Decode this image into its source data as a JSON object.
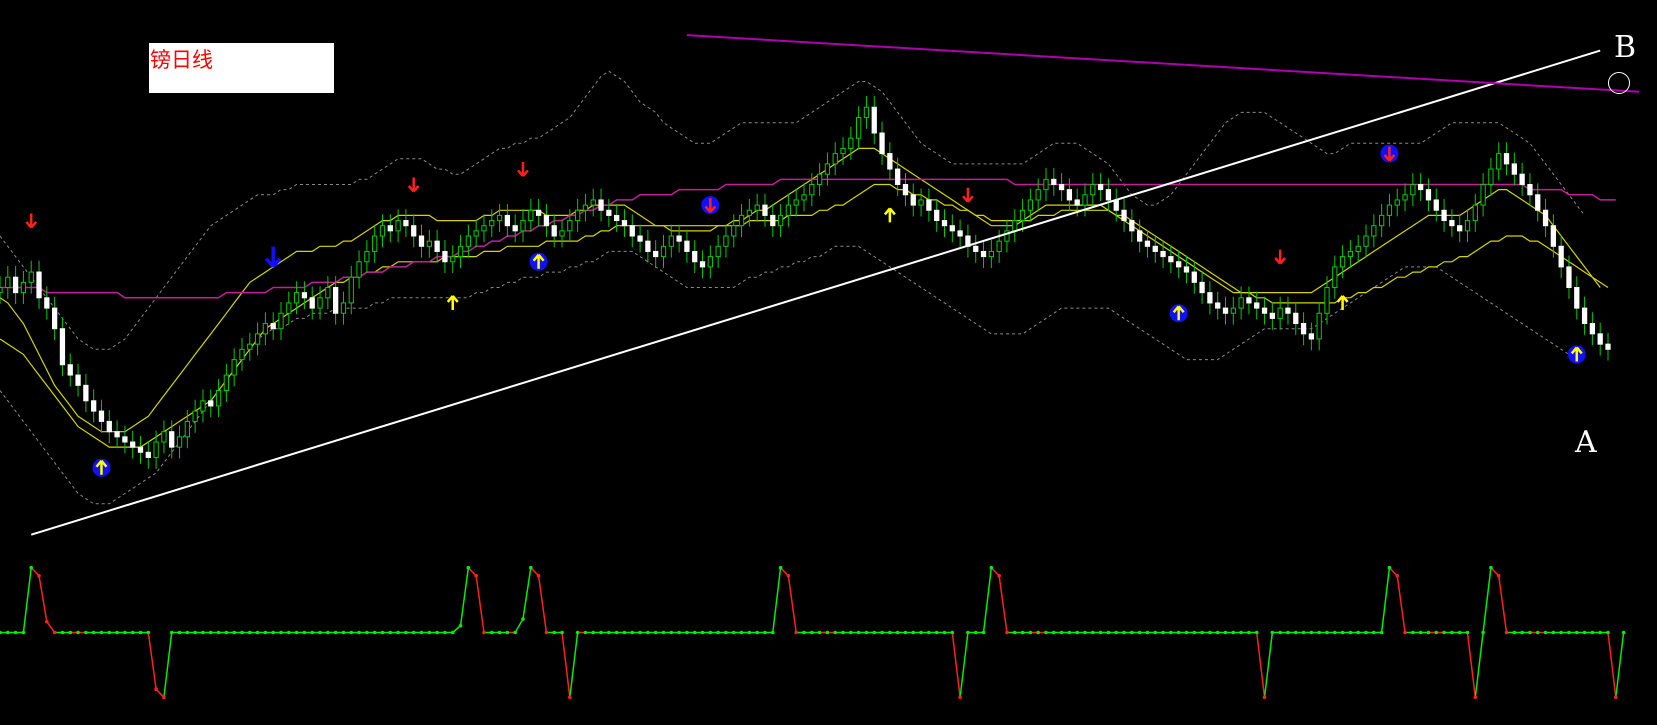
{
  "chart_data": {
    "type": "candlestick",
    "title": "镑日线",
    "point_labels": {
      "a": "A",
      "b": "B"
    },
    "colors": {
      "background": "#000000",
      "up_candle": "#e8ffe0",
      "down_candle": "#ffffff",
      "wick": "#00cc00",
      "bollinger": "#8a8a8a",
      "ma_fast": "#d4d400",
      "ma_long": "#c0209a",
      "trendline_support": "#ffffff",
      "trendline_resistance": "#b000b0",
      "signal_up": "#ffff00",
      "signal_down": "#ff2020",
      "signal_badge": "#1010ff",
      "oscillator_rise": "#00ee00",
      "oscillator_fall": "#ff2020"
    },
    "close": [
      50,
      52,
      49,
      51,
      53,
      48,
      46,
      42,
      35,
      33,
      31,
      28,
      26,
      24,
      22,
      21,
      20,
      19,
      18,
      17,
      20,
      22,
      19,
      21,
      24,
      26,
      28,
      27,
      30,
      33,
      36,
      38,
      39,
      41,
      43,
      42,
      45,
      47,
      49,
      48,
      46,
      48,
      50,
      45,
      47,
      52,
      55,
      57,
      60,
      62,
      61,
      63,
      62,
      60,
      58,
      59,
      57,
      55,
      56,
      58,
      60,
      61,
      62,
      63,
      64,
      62,
      61,
      63,
      65,
      64,
      62,
      60,
      61,
      63,
      65,
      66,
      67,
      65,
      64,
      63,
      62,
      60,
      59,
      57,
      56,
      58,
      60,
      59,
      57,
      55,
      54,
      56,
      58,
      60,
      62,
      64,
      65,
      66,
      64,
      62,
      64,
      66,
      67,
      68,
      70,
      72,
      74,
      76,
      77,
      79,
      83,
      85,
      80,
      76,
      73,
      70,
      68,
      66,
      67,
      65,
      63,
      62,
      61,
      60,
      58,
      57,
      56,
      57,
      59,
      61,
      63,
      65,
      67,
      69,
      71,
      70,
      69,
      67,
      66,
      68,
      70,
      69,
      67,
      65,
      63,
      61,
      59,
      58,
      57,
      56,
      55,
      54,
      53,
      51,
      49,
      47,
      46,
      45,
      46,
      48,
      47,
      46,
      45,
      44,
      46,
      45,
      43,
      41,
      40,
      45,
      50,
      54,
      56,
      57,
      58,
      60,
      62,
      64,
      66,
      67,
      68,
      70,
      69,
      67,
      65,
      63,
      62,
      61,
      63,
      66,
      70,
      73,
      76,
      74,
      72,
      70,
      68,
      65,
      62,
      58,
      54,
      50,
      46,
      43,
      41,
      39,
      38
    ],
    "bollinger_upper": [
      60,
      58,
      56,
      54,
      52,
      50,
      48,
      46,
      44,
      42,
      40,
      39,
      38,
      38,
      38,
      39,
      40,
      42,
      44,
      46,
      48,
      50,
      52,
      54,
      56,
      58,
      60,
      62,
      63,
      64,
      65,
      66,
      67,
      68,
      68,
      68,
      69,
      69,
      70,
      70,
      70,
      70,
      70,
      70,
      70,
      70,
      71,
      71,
      72,
      73,
      74,
      75,
      75,
      75,
      75,
      74,
      73,
      73,
      72,
      72,
      73,
      74,
      75,
      76,
      77,
      77,
      78,
      78,
      79,
      79,
      80,
      81,
      82,
      83,
      85,
      87,
      89,
      91,
      92,
      91,
      90,
      88,
      86,
      85,
      84,
      82,
      81,
      80,
      79,
      78,
      78,
      78,
      79,
      80,
      81,
      82,
      82,
      82,
      82,
      82,
      82,
      82,
      82,
      83,
      84,
      85,
      86,
      87,
      88,
      89,
      90,
      90,
      89,
      88,
      86,
      84,
      82,
      80,
      78,
      77,
      76,
      75,
      74,
      74,
      74,
      74,
      74,
      74,
      74,
      74,
      74,
      74,
      75,
      76,
      77,
      78,
      78,
      78,
      78,
      77,
      76,
      75,
      74,
      72,
      70,
      68,
      67,
      66,
      66,
      67,
      68,
      70,
      72,
      74,
      76,
      78,
      80,
      82,
      83,
      84,
      84,
      84,
      84,
      83,
      82,
      81,
      80,
      79,
      78,
      77,
      76,
      76,
      77,
      78,
      78,
      78,
      78,
      78,
      78,
      78,
      78,
      78,
      78,
      79,
      80,
      81,
      82,
      82,
      82,
      82,
      82,
      82,
      82,
      81,
      80,
      79,
      78,
      76,
      74,
      72,
      70,
      68,
      66,
      64
    ],
    "bollinger_lower": [
      30,
      28,
      26,
      24,
      22,
      20,
      18,
      16,
      14,
      12,
      10,
      9,
      8,
      8,
      8,
      9,
      10,
      11,
      12,
      13,
      14,
      16,
      18,
      20,
      22,
      24,
      26,
      28,
      30,
      32,
      34,
      36,
      38,
      40,
      41,
      42,
      42,
      43,
      44,
      44,
      45,
      45,
      45,
      46,
      46,
      46,
      46,
      46,
      47,
      47,
      48,
      48,
      48,
      48,
      48,
      48,
      48,
      48,
      48,
      48,
      48,
      49,
      49,
      50,
      50,
      51,
      51,
      52,
      52,
      52,
      53,
      53,
      53,
      54,
      54,
      55,
      55,
      56,
      57,
      57,
      57,
      57,
      56,
      55,
      54,
      53,
      52,
      51,
      50,
      50,
      50,
      50,
      50,
      50,
      50,
      51,
      52,
      52,
      53,
      53,
      54,
      54,
      55,
      55,
      56,
      56,
      57,
      58,
      58,
      58,
      58,
      57,
      56,
      55,
      54,
      53,
      52,
      51,
      50,
      49,
      48,
      47,
      46,
      45,
      44,
      43,
      42,
      41,
      41,
      41,
      41,
      41,
      42,
      43,
      44,
      45,
      46,
      46,
      46,
      46,
      46,
      46,
      46,
      45,
      44,
      43,
      42,
      41,
      40,
      39,
      38,
      37,
      36,
      36,
      36,
      36,
      36,
      37,
      38,
      39,
      40,
      41,
      42,
      42,
      42,
      42,
      42,
      42,
      42,
      43,
      44,
      45,
      46,
      47,
      48,
      49,
      50,
      51,
      52,
      53,
      54,
      54,
      54,
      54,
      54,
      53,
      52,
      51,
      50,
      49,
      48,
      47,
      46,
      45,
      44,
      43,
      42,
      41,
      40,
      39,
      38,
      37,
      36
    ],
    "ma_fast": [
      48,
      47,
      45,
      43,
      40,
      37,
      34,
      31,
      29,
      27,
      25,
      24,
      23,
      22,
      22,
      22,
      22,
      23,
      24,
      25,
      27,
      29,
      31,
      33,
      35,
      37,
      39,
      41,
      43,
      45,
      47,
      49,
      51,
      52,
      53,
      54,
      55,
      56,
      57,
      57,
      57,
      58,
      58,
      58,
      59,
      59,
      60,
      61,
      62,
      63,
      63,
      64,
      64,
      64,
      64,
      64,
      63,
      63,
      63,
      63,
      63,
      63,
      64,
      64,
      65,
      65,
      65,
      65,
      65,
      65,
      64,
      64,
      64,
      64,
      65,
      65,
      66,
      66,
      66,
      66,
      66,
      65,
      64,
      63,
      62,
      62,
      61,
      61,
      61,
      61,
      61,
      61,
      62,
      62,
      63,
      63,
      64,
      65,
      65,
      66,
      67,
      68,
      69,
      70,
      71,
      72,
      73,
      74,
      75,
      76,
      77,
      77,
      77,
      76,
      75,
      74,
      73,
      72,
      71,
      70,
      69,
      68,
      67,
      66,
      65,
      64,
      63,
      62,
      62,
      62,
      62,
      63,
      64,
      65,
      66,
      66,
      66,
      66,
      66,
      66,
      66,
      66,
      65,
      64,
      63,
      62,
      61,
      60,
      59,
      58,
      57,
      56,
      55,
      54,
      53,
      52,
      51,
      50,
      49,
      49,
      49,
      49,
      49,
      49,
      49,
      49,
      49,
      49,
      49,
      50,
      51,
      52,
      53,
      54,
      55,
      56,
      57,
      58,
      59,
      60,
      61,
      62,
      63,
      64,
      64,
      64,
      64,
      64,
      65,
      66,
      67,
      68,
      69,
      69,
      68,
      67,
      66,
      65,
      64,
      62,
      60,
      58,
      56,
      54,
      52,
      50
    ],
    "ma_mid": [
      40,
      39,
      38,
      37,
      35,
      33,
      31,
      29,
      27,
      25,
      23,
      22,
      21,
      20,
      19,
      19,
      19,
      19,
      19,
      20,
      21,
      22,
      23,
      24,
      25,
      26,
      27,
      28,
      30,
      32,
      34,
      36,
      38,
      40,
      42,
      43,
      44,
      45,
      46,
      47,
      48,
      49,
      50,
      51,
      51,
      52,
      52,
      53,
      53,
      54,
      54,
      55,
      55,
      55,
      55,
      55,
      55,
      56,
      56,
      56,
      56,
      56,
      57,
      57,
      57,
      58,
      58,
      58,
      58,
      58,
      59,
      59,
      59,
      59,
      59,
      60,
      60,
      61,
      61,
      62,
      62,
      62,
      62,
      62,
      62,
      62,
      62,
      62,
      62,
      62,
      62,
      62,
      62,
      62,
      62,
      62,
      63,
      63,
      63,
      63,
      63,
      64,
      64,
      64,
      64,
      65,
      65,
      66,
      66,
      67,
      68,
      69,
      70,
      70,
      70,
      69,
      69,
      68,
      68,
      67,
      67,
      66,
      66,
      65,
      65,
      64,
      64,
      63,
      63,
      63,
      63,
      63,
      63,
      64,
      64,
      64,
      65,
      65,
      65,
      65,
      65,
      65,
      65,
      64,
      64,
      63,
      62,
      61,
      60,
      59,
      58,
      57,
      56,
      55,
      54,
      53,
      52,
      51,
      50,
      49,
      49,
      48,
      48,
      47,
      47,
      47,
      47,
      47,
      47,
      47,
      47,
      47,
      48,
      48,
      49,
      49,
      50,
      50,
      51,
      52,
      52,
      53,
      53,
      54,
      54,
      55,
      55,
      56,
      56,
      57,
      58,
      59,
      59,
      60,
      60,
      60,
      59,
      59,
      58,
      57,
      56,
      55,
      54,
      53,
      52,
      51,
      50
    ],
    "ma_long": [
      50,
      50,
      50,
      50,
      50,
      50,
      49,
      49,
      49,
      49,
      49,
      49,
      49,
      49,
      49,
      49,
      48,
      48,
      48,
      48,
      48,
      48,
      48,
      48,
      48,
      48,
      48,
      48,
      48,
      49,
      49,
      49,
      49,
      49,
      49,
      50,
      50,
      50,
      50,
      50,
      51,
      51,
      51,
      51,
      52,
      52,
      52,
      53,
      53,
      53,
      54,
      54,
      54,
      55,
      55,
      55,
      56,
      56,
      56,
      57,
      57,
      58,
      58,
      59,
      59,
      60,
      60,
      61,
      61,
      62,
      62,
      63,
      63,
      64,
      64,
      65,
      65,
      66,
      66,
      67,
      67,
      67,
      68,
      68,
      68,
      68,
      68,
      69,
      69,
      69,
      69,
      69,
      69,
      70,
      70,
      70,
      70,
      70,
      70,
      70,
      71,
      71,
      71,
      71,
      71,
      71,
      71,
      71,
      71,
      71,
      71,
      71,
      71,
      71,
      71,
      71,
      71,
      71,
      71,
      71,
      71,
      71,
      71,
      71,
      71,
      71,
      71,
      71,
      71,
      71,
      70,
      70,
      70,
      70,
      70,
      70,
      70,
      70,
      70,
      70,
      70,
      70,
      70,
      70,
      70,
      70,
      70,
      70,
      70,
      70,
      70,
      70,
      70,
      70,
      70,
      70,
      70,
      70,
      70,
      70,
      70,
      70,
      70,
      70,
      70,
      70,
      70,
      70,
      70,
      70,
      70,
      70,
      70,
      70,
      70,
      70,
      70,
      70,
      70,
      70,
      70,
      70,
      70,
      70,
      70,
      70,
      70,
      70,
      70,
      70,
      70,
      70,
      70,
      70,
      70,
      70,
      69,
      69,
      69,
      69,
      69,
      68,
      68,
      68,
      68,
      67,
      67,
      67
    ],
    "ylim": [
      0,
      100
    ],
    "trendlines": [
      {
        "name": "support",
        "from_x": 4,
        "from_y": 2,
        "to_x": 205,
        "to_y": 96
      },
      {
        "name": "resistance",
        "from_x": 88,
        "from_y": 99,
        "to_x": 210,
        "to_y": 88
      }
    ],
    "signals": [
      {
        "x": 4,
        "kind": "down",
        "badge": false
      },
      {
        "x": 13,
        "kind": "up",
        "badge": true
      },
      {
        "x": 35,
        "kind": "down-big",
        "badge": false
      },
      {
        "x": 53,
        "kind": "down",
        "badge": false
      },
      {
        "x": 58,
        "kind": "up",
        "badge": false
      },
      {
        "x": 67,
        "kind": "down",
        "badge": false
      },
      {
        "x": 69,
        "kind": "up",
        "badge": true
      },
      {
        "x": 91,
        "kind": "down",
        "badge": true
      },
      {
        "x": 114,
        "kind": "up",
        "badge": false
      },
      {
        "x": 124,
        "kind": "down",
        "badge": false
      },
      {
        "x": 151,
        "kind": "up",
        "badge": true
      },
      {
        "x": 164,
        "kind": "down",
        "badge": false
      },
      {
        "x": 172,
        "kind": "up",
        "badge": false
      },
      {
        "x": 178,
        "kind": "down",
        "badge": true
      },
      {
        "x": 202,
        "kind": "up",
        "badge": true
      }
    ],
    "oscillator": {
      "ylim": [
        0,
        100
      ],
      "values": [
        50,
        50,
        50,
        50,
        98,
        92,
        58,
        50,
        50,
        50,
        50,
        50,
        50,
        50,
        50,
        50,
        50,
        50,
        50,
        50,
        8,
        2,
        50,
        50,
        50,
        50,
        50,
        50,
        50,
        50,
        50,
        50,
        50,
        50,
        50,
        50,
        50,
        50,
        50,
        50,
        50,
        50,
        50,
        50,
        50,
        50,
        50,
        50,
        50,
        50,
        50,
        50,
        50,
        50,
        50,
        50,
        50,
        50,
        50,
        55,
        98,
        92,
        50,
        50,
        50,
        50,
        50,
        60,
        98,
        92,
        50,
        50,
        50,
        2,
        50,
        50,
        50,
        50,
        50,
        50,
        50,
        50,
        50,
        50,
        50,
        50,
        50,
        50,
        50,
        50,
        50,
        50,
        50,
        50,
        50,
        50,
        50,
        50,
        50,
        50,
        98,
        92,
        50,
        50,
        50,
        50,
        50,
        50,
        50,
        50,
        50,
        50,
        50,
        50,
        50,
        50,
        50,
        50,
        50,
        50,
        50,
        50,
        50,
        2,
        50,
        50,
        50,
        98,
        92,
        50,
        50,
        50,
        50,
        50,
        50,
        50,
        50,
        50,
        50,
        50,
        50,
        50,
        50,
        50,
        50,
        50,
        50,
        50,
        50,
        50,
        50,
        50,
        50,
        50,
        50,
        50,
        50,
        50,
        50,
        50,
        50,
        50,
        2,
        50,
        50,
        50,
        50,
        50,
        50,
        50,
        50,
        50,
        50,
        50,
        50,
        50,
        50,
        50,
        98,
        92,
        50,
        50,
        50,
        50,
        50,
        50,
        50,
        50,
        50,
        2,
        50,
        98,
        92,
        50,
        50,
        50,
        50,
        50,
        50,
        50,
        50,
        50,
        50,
        50,
        50,
        50,
        50,
        2,
        50
      ]
    }
  }
}
